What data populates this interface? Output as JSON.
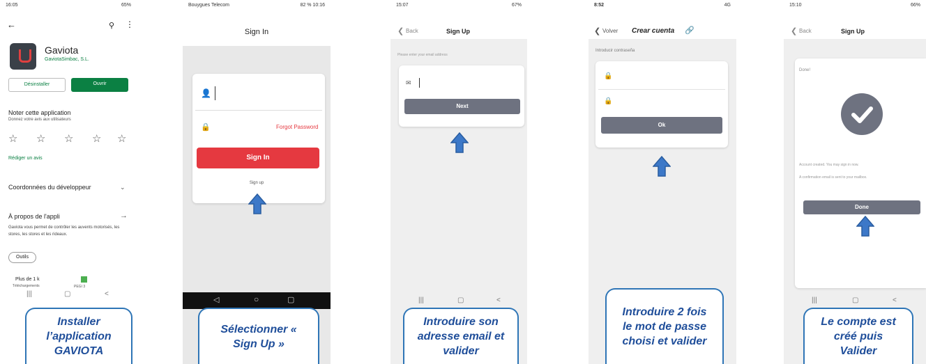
{
  "phone1": {
    "status_time": "16:05",
    "status_right": "65%",
    "app_name": "Gaviota",
    "developer": "GaviotaSimbac, S.L.",
    "uninstall_label": "Désinstaller",
    "open_label": "Ouvrir",
    "rate_title": "Noter cette application",
    "rate_subtitle": "Donnez votre avis aux utilisateurs",
    "write_review": "Rédiger un avis",
    "dev_contact": "Coordonnées du développeur",
    "about_title": "À propos de l'appli",
    "about_text": "Gaviota vous permet de contrôler les auvents motorisés, les stores, les stores et les rideaux.",
    "tag": "Outils",
    "downloads": "Plus de 1 k",
    "downloads_label": "Téléchargements",
    "pegi": "PEGI 3"
  },
  "phone2": {
    "status_left": "Bouygues Telecom",
    "status_right": "82 % 10:16",
    "title": "Sign In",
    "forgot": "Forgot Password",
    "sign_in_btn": "Sign In",
    "sign_up_link": "Sign up"
  },
  "phone3": {
    "status_time": "15:07",
    "status_right": "67%",
    "back": "Back",
    "title": "Sign Up",
    "hint": "Please enter your email address",
    "next_btn": "Next"
  },
  "phone4": {
    "status_time": "8:52",
    "status_right": "4G",
    "back": "Volver",
    "title": "Crear cuenta",
    "hint": "Introducir contraseña",
    "ok_btn": "Ok"
  },
  "phone5": {
    "status_time": "15:10",
    "status_right": "66%",
    "back": "Back",
    "title": "Sign Up",
    "done_label": "Done!",
    "msg1": "Account created. You may sign in now.",
    "msg2": "A confirmation email is sent to your mailbox.",
    "done_btn": "Done"
  },
  "captions": {
    "c1": "Installer l’application GAVIOTA",
    "c2": "Sélectionner « Sign Up »",
    "c3": "Introduire son adresse email et valider",
    "c4": "Introduire 2 fois le mot de passe choisi et valider",
    "c5": "Le compte est créé puis Valider"
  },
  "colors": {
    "accent_blue": "#2e75b6",
    "green": "#0b8043",
    "red": "#e53940",
    "button_gray": "#6e7280"
  }
}
